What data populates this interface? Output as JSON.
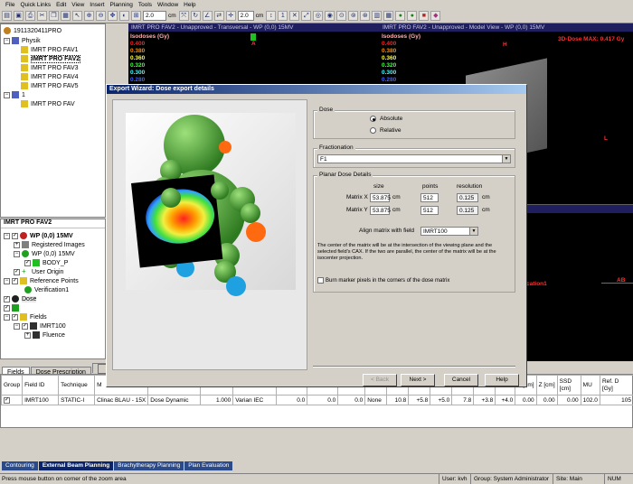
{
  "menu": [
    "File",
    "Quick Links",
    "Edit",
    "View",
    "Insert",
    "Planning",
    "Tools",
    "Window",
    "Help"
  ],
  "toolbar": {
    "zoom_value": "2.0",
    "zoom_unit": "cm",
    "slice_value": "2.0",
    "slice_unit": "cm"
  },
  "tree": {
    "root": "1911320411PRO",
    "items": [
      "Physik",
      "IMRT PRO FAV1",
      "IMRT PRO FAV2",
      "IMRT PRO FAV3",
      "IMRT PRO FAV4",
      "IMRT PRO FAV5",
      "1",
      "IMRT PRO FAV"
    ]
  },
  "plan_tree": {
    "header": "IMRT PRO FAV2",
    "items": [
      "WP (0,0) 15MV",
      "Registered Images",
      "WP (0,0) 15MV",
      "BODY_P",
      "User Origin",
      "Reference Points",
      "Verification1",
      "Dose",
      "Fields",
      "IMRT100",
      "Fluence"
    ]
  },
  "viewports": {
    "left_title": "IMRT PRO FAV2 - Unapproved - Transversal - WP (0,0) 15MV",
    "right_title": "IMRT PRO FAV2 - Unapproved - Model View - WP (0,0) 15MV",
    "isodose_label": "Isodoses (Gy)",
    "isodoses": [
      {
        "v": "0.400",
        "c": "#ff2020"
      },
      {
        "v": "0.380",
        "c": "#ff8c00"
      },
      {
        "v": "0.360",
        "c": "#ffff40"
      },
      {
        "v": "0.320",
        "c": "#40ff40"
      },
      {
        "v": "0.300",
        "c": "#40ffff"
      },
      {
        "v": "0.280",
        "c": "#4060ff"
      }
    ],
    "dose_max": "3D-Dose MAX: 0.417 Gy",
    "marker_h": "H",
    "marker_l": "L",
    "marker_a": "A",
    "lower_title": "MV",
    "lower_label": "cation1",
    "marker_ab": "AB"
  },
  "dialog": {
    "title": "Export Wizard: Dose export details",
    "dose_group": "Dose",
    "absolute": "Absolute",
    "relative": "Relative",
    "fractionation_group": "Fractionation",
    "fractionation_value": "F1",
    "planar_group": "Planar Dose Details",
    "col_size": "size",
    "col_points": "points",
    "col_resolution": "resolution",
    "matrix_x_label": "Matrix X",
    "matrix_x_size": "53.875",
    "matrix_x_points": "512",
    "matrix_x_res": "0.125",
    "matrix_y_label": "Matrix Y",
    "matrix_y_size": "53.875",
    "matrix_y_points": "512",
    "matrix_y_res": "0.125",
    "unit_cm": "cm",
    "align_label": "Align matrix with field",
    "align_value": "IMRT100",
    "description": "The center of the matrix will be at the intersection of the viewing plane and the selected field's CAX. If the two are parallel, the center of the matrix will be at the isocenter projection.",
    "burn_label": "Burn marker pixels in the corners of the dose matrix",
    "back": "< Back",
    "next": "Next >",
    "cancel": "Cancel",
    "help": "Help"
  },
  "bottom_tabs": [
    "Fields",
    "Dose Prescription",
    "F"
  ],
  "table": {
    "headers": [
      "Group",
      "Field ID",
      "Technique",
      "M",
      "",
      "",
      "",
      "",
      "",
      "",
      "",
      "",
      "",
      "",
      "",
      "Y [cm]",
      "Z [cm]",
      "SSD [cm]",
      "MU",
      "Ref. D [Gy]"
    ],
    "row": [
      "",
      "IMRT100",
      "STATIC-I",
      "Clinac BLAU - 15X",
      "Dose Dynamic",
      "1.000",
      "Varian IEC",
      "0.0",
      "0.0",
      "0.0",
      "None",
      "10.8",
      "+5.8",
      "+5.0",
      "7.8",
      "+3.8",
      "+4.0",
      "0.00",
      "0.00",
      "0.00",
      "102.0",
      "105"
    ]
  },
  "workspace_tabs": [
    "Contouring",
    "External Beam Planning",
    "Brachytherapy Planning",
    "Plan Evaluation"
  ],
  "status": {
    "hint": "Press mouse button on corner of the zoom area",
    "user": "User: kvh",
    "group": "Group: System Administrator",
    "site": "Site: Main",
    "num": "NUM"
  }
}
